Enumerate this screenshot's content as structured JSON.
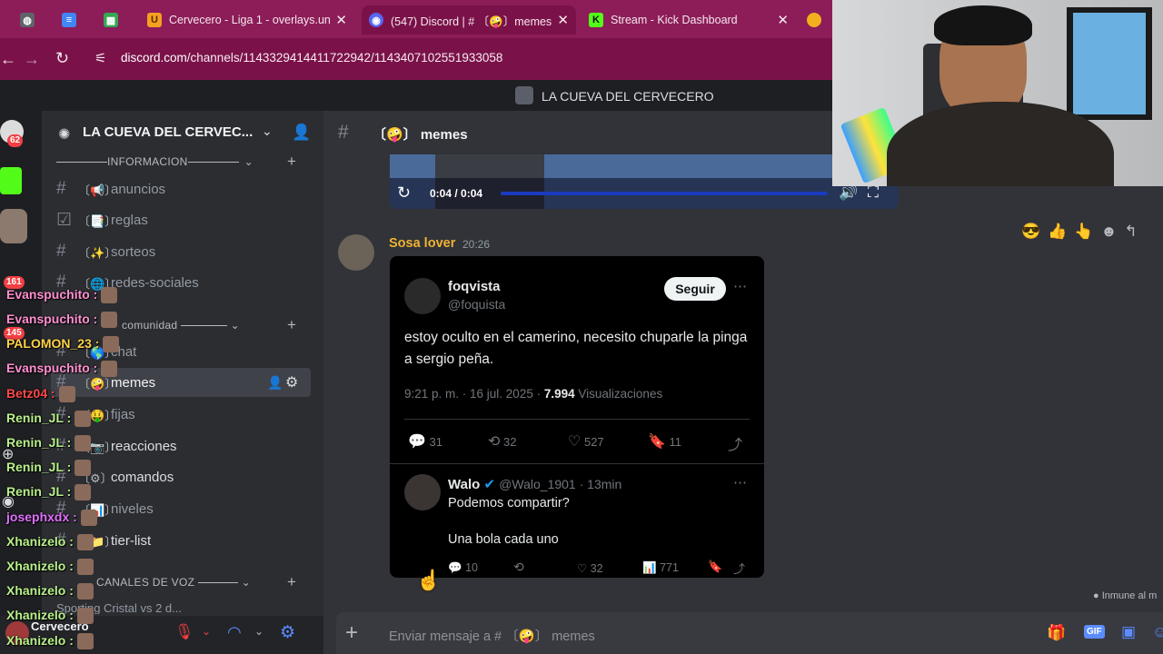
{
  "browser": {
    "tabs": [
      {
        "icon": "globe-icon",
        "label": ""
      },
      {
        "icon": "docs-icon",
        "label": ""
      },
      {
        "icon": "sheets-icon",
        "label": ""
      },
      {
        "icon": "u-icon",
        "label": "Cervecero - Liga 1 - overlays.un"
      },
      {
        "icon": "discord-icon",
        "label": "(547) Discord | # 〔🤪〕memes"
      },
      {
        "icon": "kick-icon",
        "label": "Stream - Kick Dashboard"
      }
    ],
    "url_host": "discord.com",
    "url_path": "/channels/1143329414411722942/1143407102551933058"
  },
  "discord": {
    "server_title": "LA CUEVA DEL CERVECERO",
    "server_name": "LA CUEVA DEL CERVEC...",
    "rail": {
      "badge_top": "62",
      "badge_2": "161",
      "badge_3": "145"
    },
    "categories": [
      {
        "label": "INFORMACION"
      },
      {
        "label": "comunidad"
      },
      {
        "label": "CANALES DE VOZ"
      }
    ],
    "channels": [
      {
        "emoji": "〔📢〕",
        "name": "anuncios"
      },
      {
        "emoji": "〔📑〕",
        "name": "reglas"
      },
      {
        "emoji": "〔✨〕",
        "name": "sorteos"
      },
      {
        "emoji": "〔🌐〕",
        "name": "redes-sociales"
      },
      {
        "emoji": "〔🌎〕",
        "name": "chat"
      },
      {
        "emoji": "〔🤪〕",
        "name": "memes"
      },
      {
        "emoji": "〔🤑〕",
        "name": "fijas"
      },
      {
        "emoji": "〔📷〕",
        "name": "reacciones"
      },
      {
        "emoji": "〔⚙〕",
        "name": "comandos"
      },
      {
        "emoji": "〔📊〕",
        "name": "niveles"
      },
      {
        "emoji": "〔📁〕",
        "name": "tier-list"
      }
    ],
    "voice_partial": "Sporting Cristal vs 2 d...",
    "channel_header": "〔🤪〕 memes",
    "video": {
      "time": "0:04 / 0:04",
      "progress": 1.0
    },
    "message": {
      "author": "Sosa lover",
      "time": "20:26"
    },
    "tweet": {
      "name": "foqvista",
      "handle": "@foquista",
      "follow": "Seguir",
      "text": "estoy oculto en el camerino, necesito chuparle la pinga a sergio peña.",
      "meta_date": "9:21 p. m. · 16 jul. 2025 · ",
      "meta_views": "7.994",
      "meta_views_label": " Visualizaciones",
      "replies": "31",
      "retweets": "32",
      "likes": "527",
      "bookmarks": "11",
      "reply": {
        "name": "Walo",
        "handle": "@Walo_1901 · 13min",
        "line1": "Podemos compartir?",
        "line2": "Una bola cada uno",
        "replies": "10",
        "likes": "32",
        "views": "771"
      }
    },
    "composer_placeholder": "Enviar mensaje a # 〔🤪〕 memes",
    "immune_text": "Inmune al m",
    "user_label": "Cervecero"
  },
  "overlay_chat": [
    {
      "user": "Evanspuchito :",
      "color": "#ff8fd0"
    },
    {
      "user": "Evanspuchito :",
      "color": "#ff8fd0"
    },
    {
      "user": "PALOMON_23 :",
      "color": "#ffd24a"
    },
    {
      "user": "Evanspuchito :",
      "color": "#ff8fd0"
    },
    {
      "user": "Betz04 :",
      "color": "#ff4a4a"
    },
    {
      "user": "Renin_JL :",
      "color": "#b9f08b"
    },
    {
      "user": "Renin_JL :",
      "color": "#b9f08b"
    },
    {
      "user": "Renin_JL :",
      "color": "#b9f08b"
    },
    {
      "user": "Renin_JL :",
      "color": "#b9f08b"
    },
    {
      "user": "josephxdx :",
      "color": "#e070ff"
    },
    {
      "user": "Xhanizelo :",
      "color": "#b9f08b"
    },
    {
      "user": "Xhanizelo :",
      "color": "#b9f08b"
    },
    {
      "user": "Xhanizelo :",
      "color": "#b9f08b"
    },
    {
      "user": "Xhanizelo :",
      "color": "#b9f08b"
    },
    {
      "user": "Xhanizelo :",
      "color": "#b9f08b"
    }
  ],
  "colors": {
    "browser_accent": "#8c1d58",
    "discord_bg": "#313338",
    "author_color": "#f0b232"
  }
}
